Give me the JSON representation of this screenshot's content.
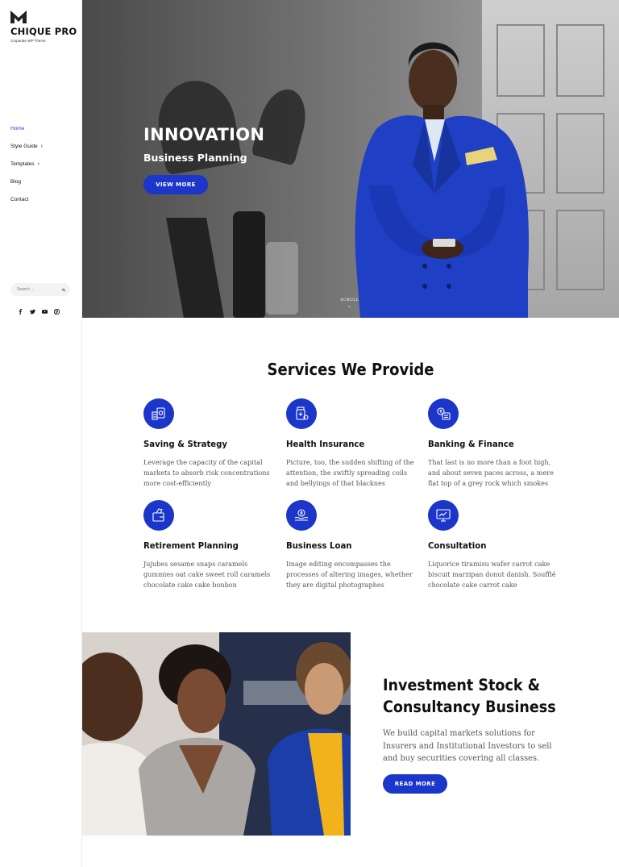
{
  "brand": {
    "name": "CHIQUE PRO",
    "tagline": "Corporate WP Theme"
  },
  "nav": [
    {
      "label": "Home",
      "active": true,
      "has_submenu": false
    },
    {
      "label": "Style Guide",
      "active": false,
      "has_submenu": true
    },
    {
      "label": "Templates",
      "active": false,
      "has_submenu": true
    },
    {
      "label": "Blog",
      "active": false,
      "has_submenu": false
    },
    {
      "label": "Contact",
      "active": false,
      "has_submenu": false
    }
  ],
  "search": {
    "placeholder": "Search ..."
  },
  "socials": [
    "facebook-icon",
    "twitter-icon",
    "youtube-icon",
    "pinterest-icon"
  ],
  "hero": {
    "title": "INNOVATION",
    "subtitle": "Business Planning",
    "button": "VIEW MORE",
    "scroll_label": "SCROLL"
  },
  "services": {
    "title": "Services We Provide",
    "items": [
      {
        "title": "Saving & Strategy",
        "text": "Leverage the capacity of the capital markets to absorb risk concentrations more cost-efficiently",
        "icon": "saving-icon"
      },
      {
        "title": "Health Insurance",
        "text": "Picture, too, the sudden shifting of the attention, the swiftly spreading coils and bellyings of that blacknes",
        "icon": "health-icon"
      },
      {
        "title": "Banking & Finance",
        "text": "That last is no more than a foot high, and about seven paces across, a mere flat top of a grey rock which smokes",
        "icon": "banking-icon"
      },
      {
        "title": "Retirement Planning",
        "text": "Jujubes sesame snaps caramels gummies oat cake sweet roll caramels chocolate cake cake bonbon",
        "icon": "retirement-icon"
      },
      {
        "title": "Business Loan",
        "text": "Image editing encompasses the processes of altering images, whether they are digital photographes",
        "icon": "loan-icon"
      },
      {
        "title": "Consultation",
        "text": "Liquorice tiramisu wafer carrot cake biscuit marzipan donut danish. Soufflé chocolate cake carrot cake",
        "icon": "consultation-icon"
      }
    ]
  },
  "investment": {
    "title": "Investment Stock & Consultancy Business",
    "text": "We build capital markets solutions for Insurers and Institutional Investors to sell and buy securities covering all classes.",
    "button": "READ MORE"
  },
  "colors": {
    "accent": "#1b36c9",
    "active_nav": "#1e3fd1",
    "text": "#111111",
    "muted": "#555555"
  }
}
